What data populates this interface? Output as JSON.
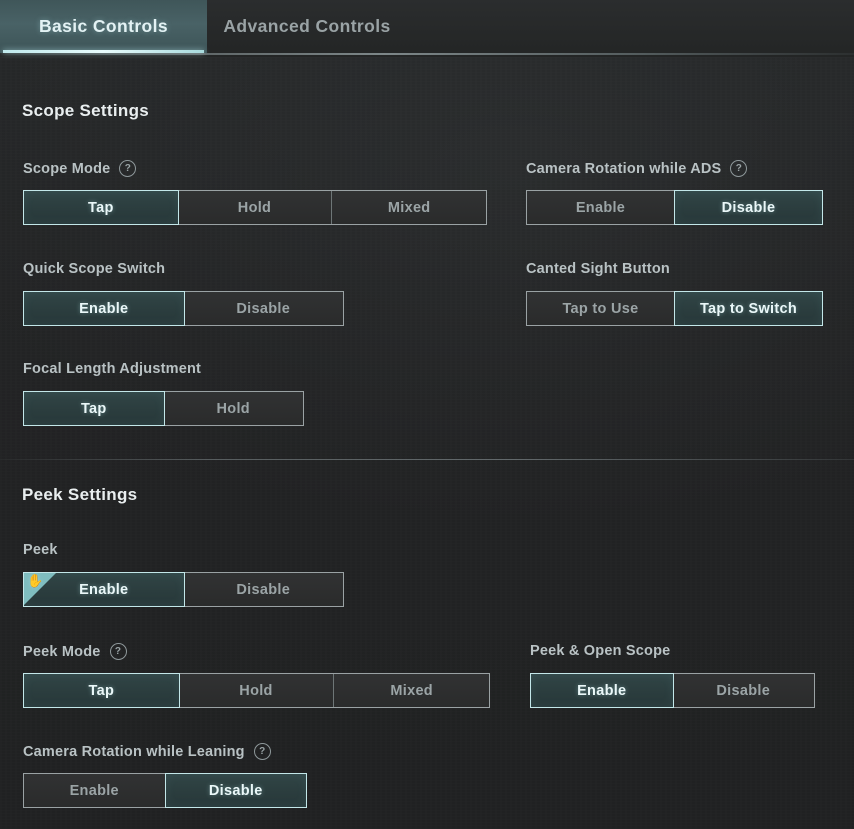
{
  "tabs": [
    {
      "label": "Basic Controls",
      "active": true
    },
    {
      "label": "Advanced Controls",
      "active": false
    }
  ],
  "sections": [
    {
      "title": "Scope Settings",
      "rows": [
        {
          "label": "Scope Mode",
          "help": true,
          "options": [
            "Tap",
            "Hold",
            "Mixed"
          ],
          "selected": "Tap"
        },
        {
          "label": "Camera Rotation while ADS",
          "help": true,
          "options": [
            "Enable",
            "Disable"
          ],
          "selected": "Disable"
        },
        {
          "label": "Quick Scope Switch",
          "help": false,
          "options": [
            "Enable",
            "Disable"
          ],
          "selected": "Enable"
        },
        {
          "label": "Canted Sight Button",
          "help": false,
          "options": [
            "Tap to Use",
            "Tap to Switch"
          ],
          "selected": "Tap to Switch"
        },
        {
          "label": "Focal Length Adjustment",
          "help": false,
          "options": [
            "Tap",
            "Hold"
          ],
          "selected": "Tap"
        }
      ]
    },
    {
      "title": "Peek Settings",
      "rows": [
        {
          "label": "Peek",
          "help": false,
          "options": [
            "Enable",
            "Disable"
          ],
          "selected": "Enable",
          "flag_icon": "hand-pointer-icon",
          "flag_glyph": "✋"
        },
        {
          "label": "Peek Mode",
          "help": true,
          "options": [
            "Tap",
            "Hold",
            "Mixed"
          ],
          "selected": "Tap"
        },
        {
          "label": "Peek & Open Scope",
          "help": false,
          "options": [
            "Enable",
            "Disable"
          ],
          "selected": "Enable"
        },
        {
          "label": "Camera Rotation while Leaning",
          "help": true,
          "options": [
            "Enable",
            "Disable"
          ],
          "selected": "Disable"
        }
      ]
    }
  ],
  "colors": {
    "background": "#232425",
    "accent_teal": "#c3e7e9",
    "selected_fill": "#2b3d3e",
    "tab_active_bg": "#496266",
    "label_text": "#b9c2c4",
    "selected_text": "#eaf7f8",
    "border": "#9aa2a4"
  }
}
